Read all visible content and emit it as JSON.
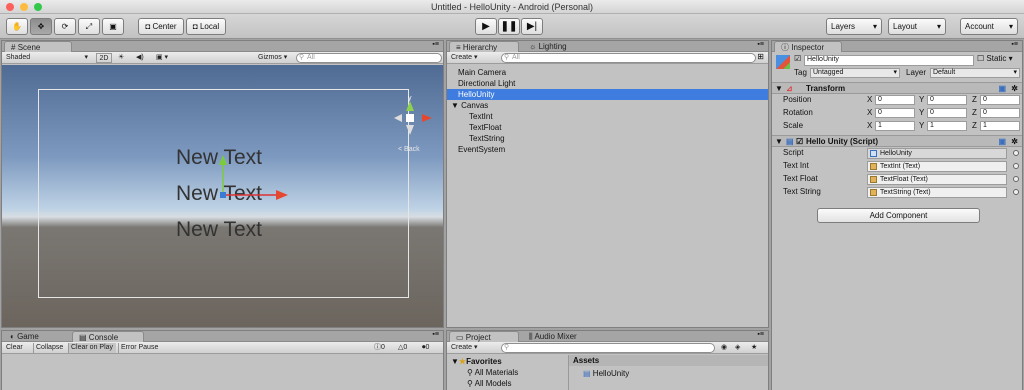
{
  "window": {
    "title": "Untitled - HelloUnity - Android (Personal)"
  },
  "toolbar": {
    "tools": [
      "hand-icon",
      "move-icon",
      "rotate-icon",
      "scale-icon",
      "rect-icon"
    ],
    "pivot": "Center",
    "space": "Local",
    "layers": "Layers",
    "layout": "Layout",
    "account": "Account"
  },
  "scene": {
    "tab": "Scene",
    "shading": "Shaded",
    "mode2d": "2D",
    "gizmos": "Gizmos",
    "search_placeholder": "All",
    "texts": [
      "New Text",
      "New Text",
      "New Text"
    ],
    "back_label": "< Back"
  },
  "hierarchy": {
    "tab": "Hierarchy",
    "tab2": "Lighting",
    "create": "Create",
    "search_placeholder": "All",
    "items": [
      "Main Camera",
      "Directional Light",
      "HelloUnity",
      "Canvas",
      "TextInt",
      "TextFloat",
      "TextString",
      "EventSystem"
    ]
  },
  "inspector": {
    "tab": "Inspector",
    "object_name": "HelloUnity",
    "static_label": "Static",
    "tag_label": "Tag",
    "tag_value": "Untagged",
    "layer_label": "Layer",
    "layer_value": "Default",
    "transform": {
      "title": "Transform",
      "rows": [
        {
          "label": "Position",
          "x": "0",
          "y": "0",
          "z": "0"
        },
        {
          "label": "Rotation",
          "x": "0",
          "y": "0",
          "z": "0"
        },
        {
          "label": "Scale",
          "x": "1",
          "y": "1",
          "z": "1"
        }
      ]
    },
    "script": {
      "title": "Hello Unity (Script)",
      "rows": [
        {
          "label": "Script",
          "value": "HelloUnity"
        },
        {
          "label": "Text Int",
          "value": "TextInt (Text)"
        },
        {
          "label": "Text Float",
          "value": "TextFloat (Text)"
        },
        {
          "label": "Text String",
          "value": "TextString (Text)"
        }
      ]
    },
    "add_component": "Add Component"
  },
  "console": {
    "tab_game": "Game",
    "tab_console": "Console",
    "buttons": [
      "Clear",
      "Collapse",
      "Clear on Play",
      "Error Pause"
    ],
    "counts": [
      "0",
      "0",
      "0"
    ]
  },
  "project": {
    "tab": "Project",
    "tab2": "Audio Mixer",
    "create": "Create",
    "favorites": "Favorites",
    "fav_items": [
      "All Materials",
      "All Models"
    ],
    "assets_header": "Assets",
    "assets": [
      "HelloUnity"
    ]
  },
  "colors": {
    "selection": "#3e7ce0",
    "panel": "#c2c2c2"
  }
}
